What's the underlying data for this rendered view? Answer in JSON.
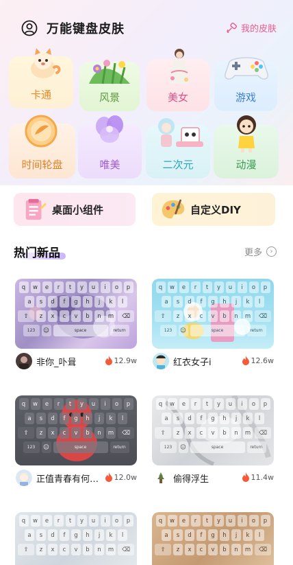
{
  "header": {
    "title": "万能键盘皮肤",
    "my_skin_label": "我的皮肤"
  },
  "categories": [
    {
      "label": "卡通",
      "icon": "cartoon-cat-icon",
      "color": "#e98a2c"
    },
    {
      "label": "风景",
      "icon": "scenery-flowers-icon",
      "color": "#5b9a3a"
    },
    {
      "label": "美女",
      "icon": "beauty-girl-icon",
      "color": "#e4508a"
    },
    {
      "label": "游戏",
      "icon": "gamepad-icon",
      "color": "#3c7fd6"
    },
    {
      "label": "时间轮盘",
      "icon": "time-wheel-icon",
      "color": "#e4812a"
    },
    {
      "label": "唯美",
      "icon": "crystal-flower-icon",
      "color": "#9b5bd6"
    },
    {
      "label": "二次元",
      "icon": "anime-girl-icon",
      "color": "#2aa4b8"
    },
    {
      "label": "动漫",
      "icon": "anime-doll-icon",
      "color": "#3a9a54"
    }
  ],
  "tools": [
    {
      "label": "桌面小组件",
      "icon": "widget-clipboard-icon"
    },
    {
      "label": "自定义DIY",
      "icon": "palette-icon"
    }
  ],
  "hot": {
    "title": "热门新品",
    "more": "更多"
  },
  "keyboard": {
    "row1": [
      "q",
      "w",
      "e",
      "r",
      "t",
      "y",
      "u",
      "i",
      "o",
      "p"
    ],
    "row2": [
      "a",
      "s",
      "d",
      "f",
      "g",
      "h",
      "j",
      "k",
      "l"
    ],
    "row3": [
      "z",
      "x",
      "c",
      "v",
      "b",
      "n",
      "m"
    ],
    "num": "123",
    "space": "space",
    "return": "return"
  },
  "skins": [
    {
      "user": "非你_卟咠",
      "count": "12.9w"
    },
    {
      "user": "红衣女子i",
      "count": "12.6w"
    },
    {
      "user": "正值青春有何…",
      "count": "12.0w"
    },
    {
      "user": "偷得浮生",
      "count": "11.4w"
    },
    {
      "user": "",
      "count": ""
    },
    {
      "user": "",
      "count": ""
    }
  ],
  "colors": {
    "accent_pink": "#ef5a8c",
    "fire": "#f35b3a"
  }
}
